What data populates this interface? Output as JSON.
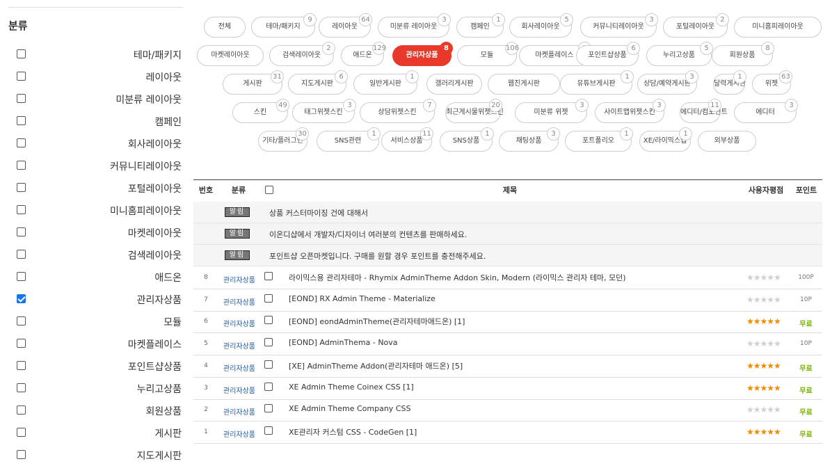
{
  "sidebar": {
    "title": "분류",
    "items": [
      {
        "label": "테마/패키지",
        "checked": false
      },
      {
        "label": "레이아웃",
        "checked": false
      },
      {
        "label": "미분류 레이아웃",
        "checked": false
      },
      {
        "label": "캠페인",
        "checked": false
      },
      {
        "label": "회사레이아웃",
        "checked": false
      },
      {
        "label": "커뮤니티레이아웃",
        "checked": false
      },
      {
        "label": "포털레이아웃",
        "checked": false
      },
      {
        "label": "미니홈피레이아웃",
        "checked": false
      },
      {
        "label": "마켓레이아웃",
        "checked": false
      },
      {
        "label": "검색레이아웃",
        "checked": false
      },
      {
        "label": "애드온",
        "checked": false
      },
      {
        "label": "관리자상품",
        "checked": true
      },
      {
        "label": "모듈",
        "checked": false
      },
      {
        "label": "마켓플레이스",
        "checked": false
      },
      {
        "label": "포인트샵상품",
        "checked": false
      },
      {
        "label": "누리고상품",
        "checked": false
      },
      {
        "label": "회원상품",
        "checked": false
      },
      {
        "label": "게시판",
        "checked": false
      },
      {
        "label": "지도게시판",
        "checked": false
      }
    ]
  },
  "pills": [
    {
      "label": "전체",
      "count": ""
    },
    {
      "label": "테마/패키지",
      "count": "9"
    },
    {
      "label": "레이아웃",
      "count": "64"
    },
    {
      "label": "미분류 레이아웃",
      "count": "3"
    },
    {
      "label": "캠페인",
      "count": "1"
    },
    {
      "label": "회사레이아웃",
      "count": "5"
    },
    {
      "label": "커뮤니티레이아웃",
      "count": "3"
    },
    {
      "label": "포털레이아웃",
      "count": "2"
    },
    {
      "label": "미니홈피레이아웃",
      "count": ""
    },
    {
      "label": "마켓레이아웃",
      "count": ""
    },
    {
      "label": "검색레이아웃",
      "count": "2"
    },
    {
      "label": "애드온",
      "count": "129"
    },
    {
      "label": "관리자상품",
      "count": "8",
      "active": true
    },
    {
      "label": "모듈",
      "count": "106"
    },
    {
      "label": "마켓플레이스",
      "count": "2"
    },
    {
      "label": "포인트샵상품",
      "count": "6"
    },
    {
      "label": "누리고상품",
      "count": "5"
    },
    {
      "label": "회원상품",
      "count": "8"
    },
    {
      "label": "게시판",
      "count": "31"
    },
    {
      "label": "지도게시판",
      "count": "6"
    },
    {
      "label": "일반게시판",
      "count": "1"
    },
    {
      "label": "갤러리게시판",
      "count": ""
    },
    {
      "label": "웹진게시판",
      "count": ""
    },
    {
      "label": "유튜브게시판",
      "count": "1"
    },
    {
      "label": "상담/예약게시판",
      "count": "3"
    },
    {
      "label": "달력게시판",
      "count": "1"
    },
    {
      "label": "위젯",
      "count": "63"
    },
    {
      "label": "스킨",
      "count": "49"
    },
    {
      "label": "태그위젯스킨",
      "count": "3"
    },
    {
      "label": "상담위젯스킨",
      "count": "7"
    },
    {
      "label": "최근게시물위젯스킨",
      "count": "20"
    },
    {
      "label": "미분류 위젯",
      "count": "3"
    },
    {
      "label": "사이트맵위젯스킨",
      "count": "3"
    },
    {
      "label": "에디터/컴포넌트",
      "count": "11"
    },
    {
      "label": "에디터",
      "count": "3"
    },
    {
      "label": "기타/플러그인",
      "count": "30"
    },
    {
      "label": "SNS관련",
      "count": "1"
    },
    {
      "label": "서비스상품",
      "count": "11"
    },
    {
      "label": "SNS상품",
      "count": "1"
    },
    {
      "label": "채팅상품",
      "count": "3"
    },
    {
      "label": "포트폴리오",
      "count": "1"
    },
    {
      "label": "XE/라이믹스앱",
      "count": "1"
    },
    {
      "label": "외부상품",
      "count": ""
    },
    {
      "label": "포트폴리오",
      "count": "1"
    }
  ],
  "table": {
    "headers": {
      "no": "번호",
      "category": "분류",
      "title": "제목",
      "rating": "사용자평점",
      "point": "포인트"
    },
    "notices": [
      {
        "tag": "알림",
        "text": "상품 커스터마이징 건에 대해서"
      },
      {
        "tag": "알림",
        "text": "이온디샵에서 개발자/디자이너 여러분의 컨텐츠를 판매하세요."
      },
      {
        "tag": "알림",
        "text": "포인트샵 오픈마켓입니다. 구매를 원할 경우 포인트를 충전해주세요."
      }
    ],
    "rows": [
      {
        "no": "8",
        "category": "관리자상품",
        "title": "라이믹스용 관리자테마 - Rhymix AdminTheme Addon Skin, Modern (라이믹스 관리자 테마, 모던)",
        "rating": 0,
        "point": "100P",
        "free": false
      },
      {
        "no": "7",
        "category": "관리자상품",
        "title": "[EOND] RX Admin Theme - Materialize",
        "rating": 0,
        "point": "10P",
        "free": false
      },
      {
        "no": "6",
        "category": "관리자상품",
        "title": "[EOND] eondAdminTheme(관리자테마애드온) [1]",
        "rating": 5,
        "point": "무료",
        "free": true
      },
      {
        "no": "5",
        "category": "관리자상품",
        "title": "[EOND] AdminThema - Nova",
        "rating": 0,
        "point": "10P",
        "free": false
      },
      {
        "no": "4",
        "category": "관리자상품",
        "title": "[XE] AdminTheme Addon(관리자테마 애드온) [5]",
        "rating": 5,
        "point": "무료",
        "free": true
      },
      {
        "no": "3",
        "category": "관리자상품",
        "title": "XE Admin Theme Coinex CSS [1]",
        "rating": 5,
        "point": "무료",
        "free": true
      },
      {
        "no": "2",
        "category": "관리자상품",
        "title": "XE Admin Theme Company CSS",
        "rating": 0,
        "point": "무료",
        "free": true
      },
      {
        "no": "1",
        "category": "관리자상품",
        "title": "XE관리자 커스텀 CSS - CodeGen [1]",
        "rating": 5,
        "point": "무료",
        "free": true
      }
    ]
  },
  "colors": {
    "accent": "#e8392b",
    "free": "#79b000",
    "star": "#f08c00",
    "link": "#1e5aa0"
  }
}
